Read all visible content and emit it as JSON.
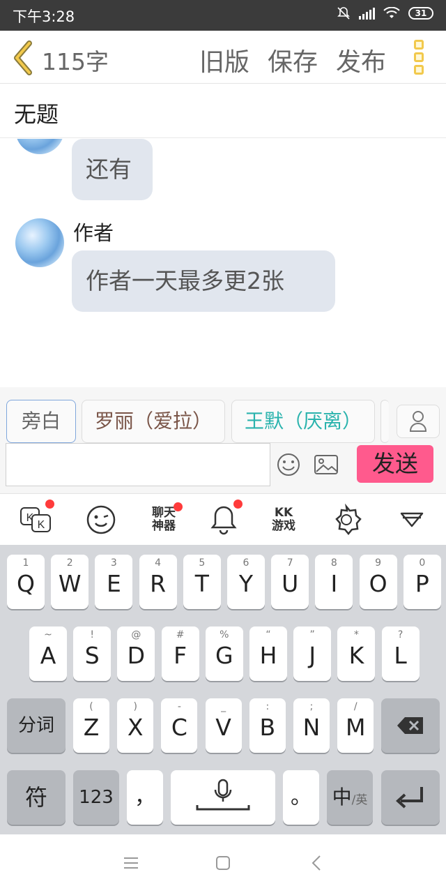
{
  "status_bar": {
    "time": "下午3:28",
    "battery": "31"
  },
  "header": {
    "char_count": "115字",
    "old_version": "旧版",
    "save": "保存",
    "publish": "发布"
  },
  "title": "无题",
  "chat": {
    "messages": [
      {
        "sender": "",
        "text": "还有"
      },
      {
        "sender": "作者",
        "text": "作者一天最多更2张"
      }
    ]
  },
  "characters": [
    {
      "label": "旁白",
      "color": "#666666",
      "selected": true
    },
    {
      "label": "罗丽（爱拉）",
      "color": "#7a5548",
      "selected": false
    },
    {
      "label": "王默（厌离）",
      "color": "#2ab3ad",
      "selected": false
    }
  ],
  "composer": {
    "input_value": "",
    "send_label": "发送"
  },
  "keyboard_toolbar": [
    {
      "icon": "kk-chat-icon",
      "badge": true
    },
    {
      "icon": "emoji-icon",
      "badge": false
    },
    {
      "label_top": "聊天",
      "label_bottom": "神器",
      "badge": true
    },
    {
      "icon": "bell-icon",
      "badge": true
    },
    {
      "label_top": "KK",
      "label_bottom": "游戏",
      "badge": false
    },
    {
      "icon": "sticker-icon",
      "badge": false
    },
    {
      "icon": "collapse-keyboard-icon",
      "badge": false
    }
  ],
  "keyboard": {
    "row1": [
      {
        "k": "Q",
        "h": "1"
      },
      {
        "k": "W",
        "h": "2"
      },
      {
        "k": "E",
        "h": "3"
      },
      {
        "k": "R",
        "h": "4"
      },
      {
        "k": "T",
        "h": "5"
      },
      {
        "k": "Y",
        "h": "6"
      },
      {
        "k": "U",
        "h": "7"
      },
      {
        "k": "I",
        "h": "8"
      },
      {
        "k": "O",
        "h": "9"
      },
      {
        "k": "P",
        "h": "0"
      }
    ],
    "row2": [
      {
        "k": "A",
        "h": "~"
      },
      {
        "k": "S",
        "h": "!"
      },
      {
        "k": "D",
        "h": "@"
      },
      {
        "k": "F",
        "h": "#"
      },
      {
        "k": "G",
        "h": "%"
      },
      {
        "k": "H",
        "h": "“"
      },
      {
        "k": "J",
        "h": "”"
      },
      {
        "k": "K",
        "h": "*"
      },
      {
        "k": "L",
        "h": "?"
      }
    ],
    "row3": [
      {
        "k": "Z",
        "h": "("
      },
      {
        "k": "X",
        "h": ")"
      },
      {
        "k": "C",
        "h": "-"
      },
      {
        "k": "V",
        "h": "_"
      },
      {
        "k": "B",
        "h": ":"
      },
      {
        "k": "N",
        "h": ";"
      },
      {
        "k": "M",
        "h": "/"
      }
    ],
    "segment_key": "分词",
    "symbol_key": "符",
    "num_key": "123",
    "comma_key": "，",
    "period_key": "。",
    "lang_main": "中",
    "lang_sub": "/英"
  }
}
